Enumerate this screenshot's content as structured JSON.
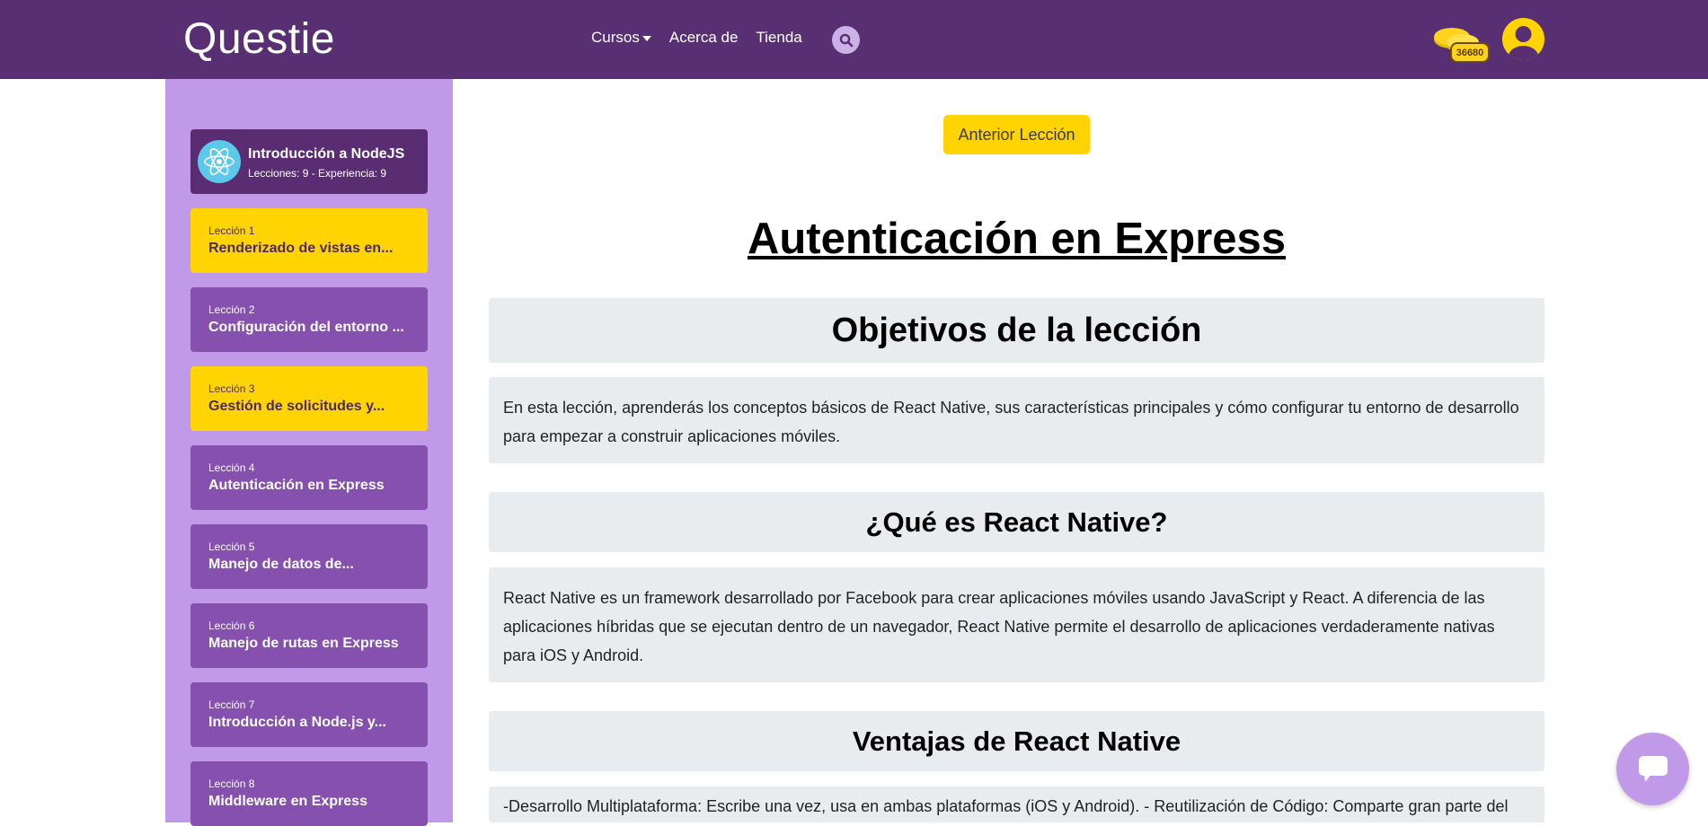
{
  "header": {
    "brand": "Questie",
    "nav": [
      {
        "label": "Cursos"
      },
      {
        "label": "Acerca de"
      },
      {
        "label": "Tienda"
      }
    ],
    "coins": "36680"
  },
  "sidebar": {
    "course": {
      "title": "Introducción a NodeJS",
      "meta": "Lecciones: 9 - Experiencia: 9"
    },
    "lessons": [
      {
        "num": "Lección 1",
        "name": "Renderizado de vistas en...",
        "completed": true
      },
      {
        "num": "Lección 2",
        "name": "Configuración del entorno ...",
        "completed": false
      },
      {
        "num": "Lección 3",
        "name": "Gestión de solicitudes y...",
        "completed": true
      },
      {
        "num": "Lección 4",
        "name": "Autenticación en Express",
        "completed": false
      },
      {
        "num": "Lección 5",
        "name": "Manejo de datos de...",
        "completed": false
      },
      {
        "num": "Lección 6",
        "name": "Manejo de rutas en Express",
        "completed": false
      },
      {
        "num": "Lección 7",
        "name": "Introducción a Node.js y...",
        "completed": false
      },
      {
        "num": "Lección 8",
        "name": "Middleware en Express",
        "completed": false
      }
    ]
  },
  "main": {
    "prev_button": "Anterior Lección",
    "title": "Autenticación en Express",
    "sections": [
      {
        "heading": "Objetivos de la lección",
        "body": "En esta lección, aprenderás los conceptos básicos de React Native, sus características principales y cómo configurar tu entorno de desarrollo para empezar a construir aplicaciones móviles."
      },
      {
        "heading": "¿Qué es React Native?",
        "body": "React Native es un framework desarrollado por Facebook para crear aplicaciones móviles usando JavaScript y React. A diferencia de las aplicaciones híbridas que se ejecutan dentro de un navegador, React Native permite el desarrollo de aplicaciones verdaderamente nativas para iOS y Android."
      },
      {
        "heading": "Ventajas de React Native",
        "body": "-Desarrollo Multiplataforma: Escribe una vez, usa en ambas plataformas (iOS y Android). - Reutilización de Código: Comparte gran parte del"
      }
    ]
  },
  "colors": {
    "navbar": "#572f72",
    "sidebar": "#c09ae8",
    "lesson_default": "#8550ae",
    "lesson_completed": "#ffd400",
    "accent": "#ffd400"
  },
  "icons": [
    "search-icon",
    "coins-icon",
    "user-avatar-icon",
    "react-logo-icon",
    "chat-icon",
    "chevron-down-icon"
  ]
}
